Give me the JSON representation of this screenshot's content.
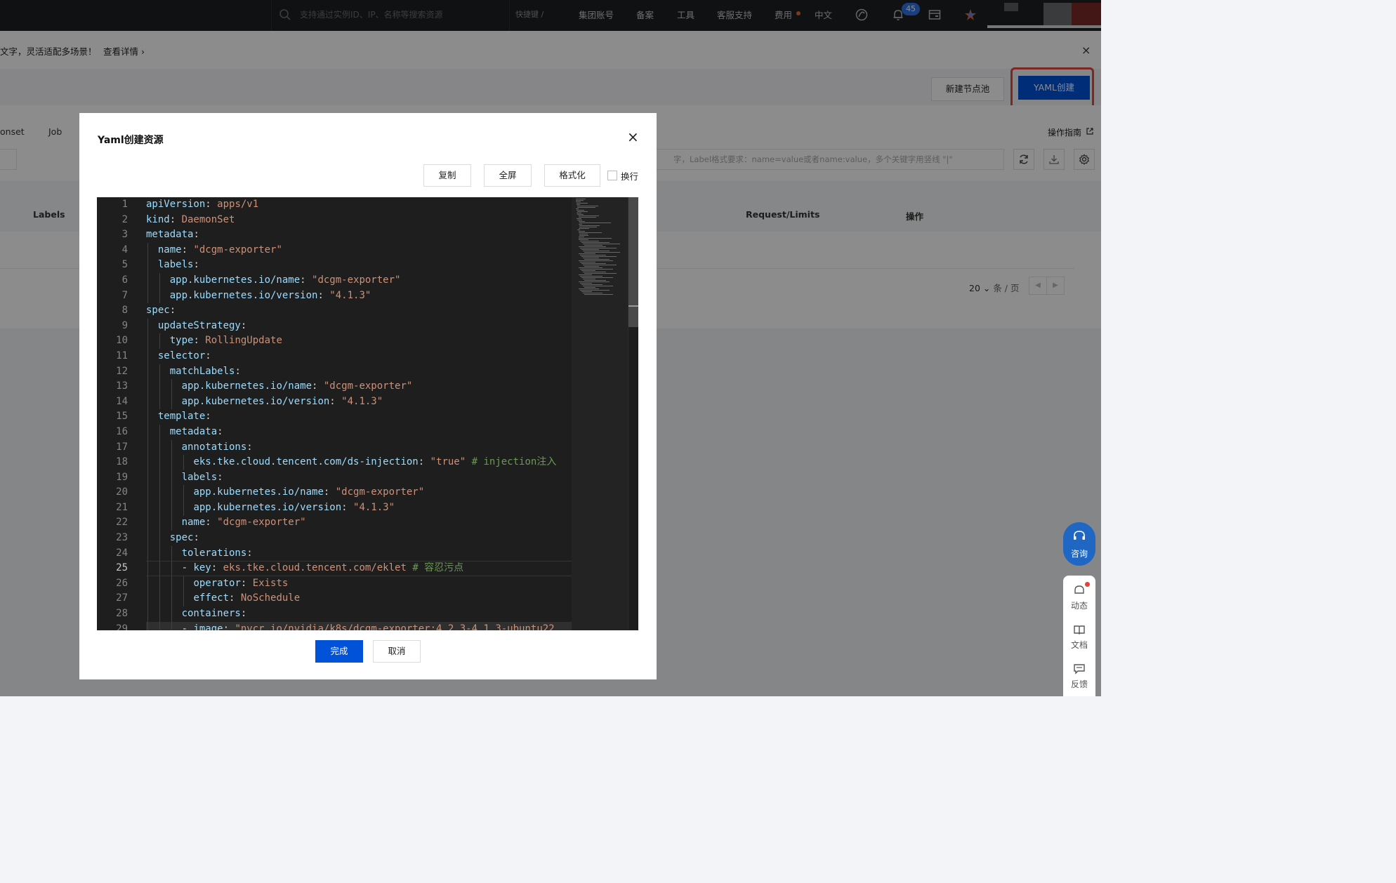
{
  "topbar": {
    "search_placeholder": "支持通过实例ID、IP、名称等搜索资源",
    "shortcut": "快捷键 /",
    "nav": [
      "集团账号",
      "备案",
      "工具",
      "客服支持",
      "费用",
      "中文"
    ],
    "notification_count": "45"
  },
  "notice": {
    "text": "文字，灵活适配多场景！",
    "link": "查看详情 ›",
    "close": "×"
  },
  "header": {
    "new_nodepool": "新建节点池",
    "yaml_create": "YAML创建",
    "highlight_color": "#e2473a"
  },
  "content": {
    "tabs": [
      "onset",
      "Job"
    ],
    "guide": "操作指南",
    "filter_placeholder": "字，Label格式要求：name=value或者name:value，多个关键字用竖线 \"|\"",
    "columns": [
      "Labels",
      "Request/Limits",
      "操作"
    ],
    "page_size": "20",
    "page_unit": "条 / 页"
  },
  "side": {
    "consult": "咨询",
    "items": [
      "动态",
      "文档",
      "反馈"
    ]
  },
  "modal": {
    "title": "Yaml创建资源",
    "close": "×",
    "buttons": {
      "copy": "复制",
      "fullscreen": "全屏",
      "format": "格式化",
      "wrap": "换行"
    },
    "wrap_checked": false,
    "confirm": "完成",
    "cancel": "取消",
    "active_line": 25,
    "code": [
      "apiVersion: apps/v1",
      "kind: DaemonSet",
      "metadata:",
      "  name: \"dcgm-exporter\"",
      "  labels:",
      "    app.kubernetes.io/name: \"dcgm-exporter\"",
      "    app.kubernetes.io/version: \"4.1.3\"",
      "spec:",
      "  updateStrategy:",
      "    type: RollingUpdate",
      "  selector:",
      "    matchLabels:",
      "      app.kubernetes.io/name: \"dcgm-exporter\"",
      "      app.kubernetes.io/version: \"4.1.3\"",
      "  template:",
      "    metadata:",
      "      annotations:",
      "        eks.tke.cloud.tencent.com/ds-injection: \"true\" # injection注入",
      "      labels:",
      "        app.kubernetes.io/name: \"dcgm-exporter\"",
      "        app.kubernetes.io/version: \"4.1.3\"",
      "      name: \"dcgm-exporter\"",
      "    spec:",
      "      tolerations:",
      "      - key: eks.tke.cloud.tencent.com/eklet # 容忍污点",
      "        operator: Exists",
      "        effect: NoSchedule",
      "      containers:",
      "      - image: \"nvcr.io/nvidia/k8s/dcgm-exporter:4.2.3-4.1.3-ubuntu22"
    ]
  }
}
